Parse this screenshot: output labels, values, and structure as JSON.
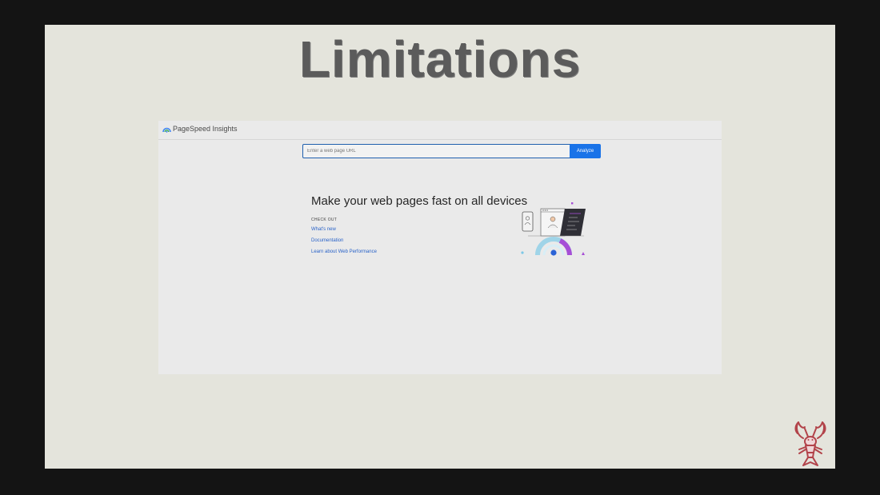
{
  "slide": {
    "title": "Limitations"
  },
  "pagespeed": {
    "brand": "PageSpeed Insights",
    "url_input": {
      "placeholder": "Enter a web page URL",
      "value": ""
    },
    "analyze_label": "Analyze",
    "headline": "Make your web pages fast on all devices",
    "check_out_label": "CHECK OUT",
    "links": [
      {
        "label": "What's new"
      },
      {
        "label": "Documentation"
      },
      {
        "label": "Learn about Web Performance"
      }
    ]
  },
  "colors": {
    "slide_background": "#e4e4dc",
    "frame_background": "#141414",
    "title_text": "#5b5b5b",
    "accent_blue": "#1a73e8",
    "link_blue": "#2a63c8",
    "mascot_red": "#b2434a"
  },
  "icons": {
    "brand_logo": "pagespeed-gauge-icon",
    "illustration": "devices-speed-illustration",
    "mascot": "lobster-icon"
  }
}
